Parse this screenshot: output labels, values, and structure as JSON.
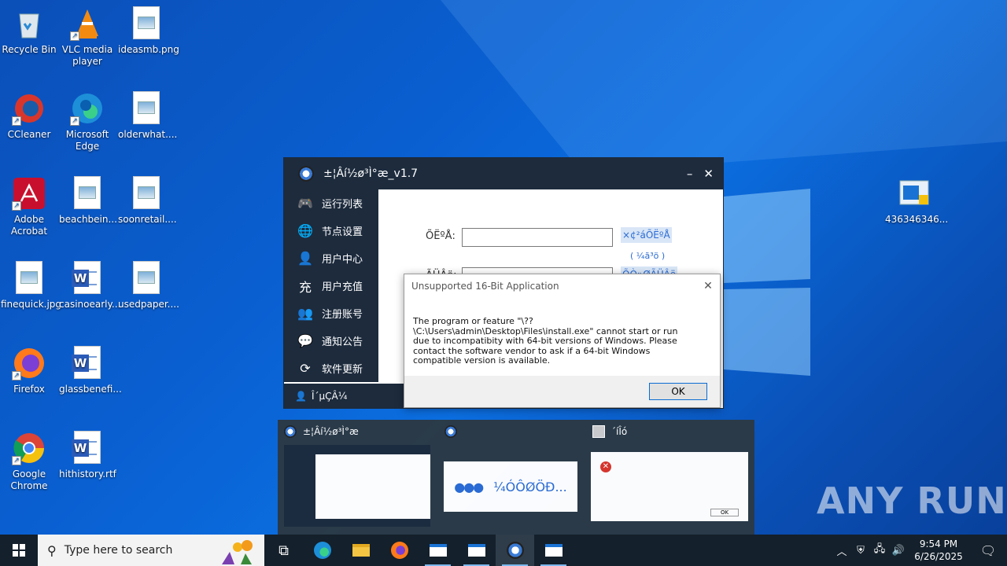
{
  "desktop": {
    "icons": [
      {
        "label": "Recycle Bin",
        "icon": "recycle-bin-icon"
      },
      {
        "label": "VLC media player",
        "icon": "vlc-icon"
      },
      {
        "label": "ideasmb.png",
        "icon": "image-file-icon"
      },
      {
        "label": "CCleaner",
        "icon": "ccleaner-icon"
      },
      {
        "label": "Microsoft Edge",
        "icon": "edge-icon"
      },
      {
        "label": "olderwhat....",
        "icon": "image-file-icon"
      },
      {
        "label": "Adobe Acrobat",
        "icon": "acrobat-icon"
      },
      {
        "label": "beachbein...",
        "icon": "image-file-icon"
      },
      {
        "label": "soonretail....",
        "icon": "image-file-icon"
      },
      {
        "label": "finequick.jpg",
        "icon": "image-file-icon"
      },
      {
        "label": "casinoearly...",
        "icon": "word-file-icon"
      },
      {
        "label": "usedpaper....",
        "icon": "image-file-icon"
      },
      {
        "label": "Firefox",
        "icon": "firefox-icon"
      },
      {
        "label": "glassbenefi...",
        "icon": "word-file-icon"
      },
      {
        "label": "Google Chrome",
        "icon": "chrome-icon"
      },
      {
        "label": "hithistory.rtf",
        "icon": "word-file-icon"
      },
      {
        "label": "436346346...",
        "icon": "installer-file-icon"
      }
    ]
  },
  "app": {
    "title": "±¦Âí½ø³Ì°æ_v1.7",
    "minimize": "–",
    "close": "✕",
    "sidebar": [
      {
        "label": "运行列表",
        "icon": "gamepad-icon",
        "glyph": "🎮"
      },
      {
        "label": "节点设置",
        "icon": "globe-icon",
        "glyph": "🌐"
      },
      {
        "label": "用户中心",
        "icon": "user-icon",
        "glyph": "👤"
      },
      {
        "label": "用户充值",
        "icon": "recharge-icon",
        "glyph": "充"
      },
      {
        "label": "注册账号",
        "icon": "add-user-icon",
        "glyph": "👥"
      },
      {
        "label": "通知公告",
        "icon": "chat-icon",
        "glyph": "💬"
      },
      {
        "label": "软件更新",
        "icon": "refresh-icon",
        "glyph": "⟳"
      }
    ],
    "bottom_label": "Î´µÇÂ¼",
    "form": {
      "account_label": "ÕËºÅ:",
      "register_link": "×¢²áÕËºÅ",
      "sub_link": "( ¼ã³ö )",
      "password_label": "ÃÜÂë:",
      "password_link": "ÕÒ»ØÃÜÂë"
    }
  },
  "dialog": {
    "title": "Unsupported 16-Bit Application",
    "message": "The program or feature \"\\??\\C:\\Users\\admin\\Desktop\\Files\\install.exe\" cannot start or run due to incompatibity with 64-bit versions of Windows. Please contact the software vendor to ask if a 64-bit Windows compatible version is available.",
    "ok_label": "OK"
  },
  "thumbnails": [
    {
      "title": "±¦Âí½ø³Ì°æ"
    },
    {
      "title": "",
      "body": "¼ÓÔØÖÐ..."
    },
    {
      "title": "´íÎó",
      "body": "OK"
    }
  ],
  "taskbar": {
    "search_placeholder": "Type here to search",
    "time": "9:54 PM",
    "date": "6/26/2025"
  },
  "watermark": "ANY RUN"
}
